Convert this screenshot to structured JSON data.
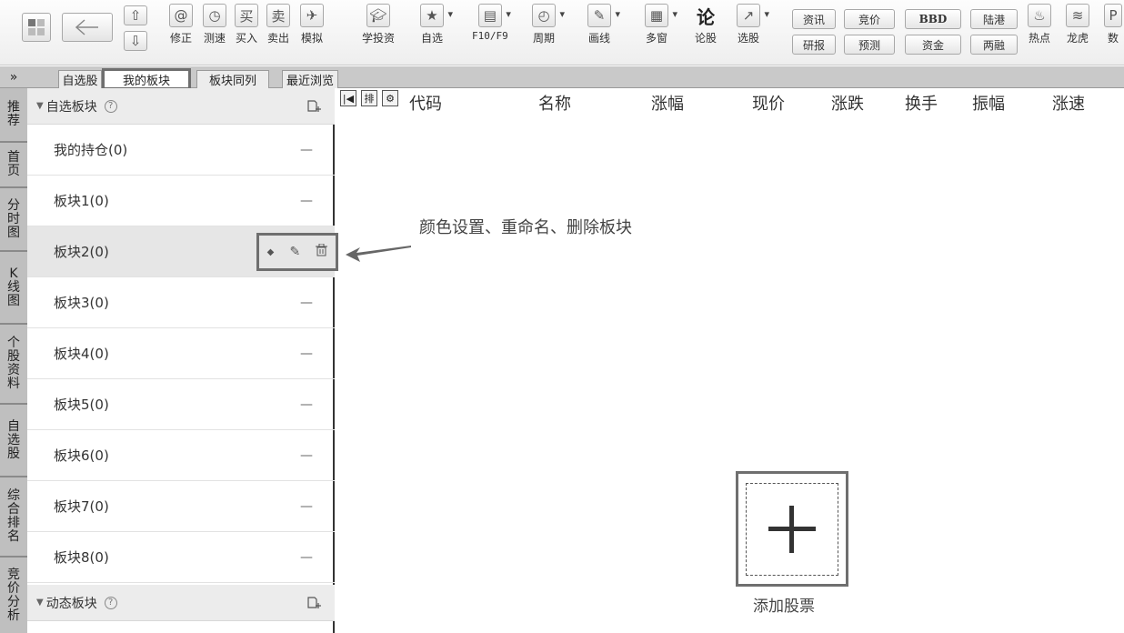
{
  "toolbar": {
    "nav_back_icon": "back-arrow-icon",
    "up_icon": "up-arrow-icon",
    "down_icon": "down-arrow-icon",
    "buttons": [
      {
        "label": "修正",
        "icon": "swirl-icon"
      },
      {
        "label": "测速",
        "icon": "clock-icon"
      },
      {
        "label": "买入",
        "icon": "buy-icon",
        "glyph": "买"
      },
      {
        "label": "卖出",
        "icon": "sell-icon",
        "glyph": "卖"
      },
      {
        "label": "模拟",
        "icon": "simulate-icon"
      },
      {
        "label": "学投资",
        "icon": "grad-cap-icon"
      },
      {
        "label": "自选",
        "icon": "star-folder-icon"
      },
      {
        "label": "F10/F9",
        "icon": "f10-icon"
      },
      {
        "label": "周期",
        "icon": "period-icon"
      },
      {
        "label": "画线",
        "icon": "pen-icon"
      },
      {
        "label": "多窗",
        "icon": "multiwindow-icon"
      },
      {
        "label": "论股",
        "icon": "discuss-icon",
        "glyph": "论"
      },
      {
        "label": "选股",
        "icon": "stock-select-icon"
      }
    ],
    "pills": [
      {
        "top": "资讯",
        "bottom": "研报"
      },
      {
        "top": "竞价",
        "bottom": "预测"
      },
      {
        "top": "BBD",
        "bottom": "资金"
      },
      {
        "top": "陆港",
        "bottom": "两融"
      }
    ],
    "right_buttons": [
      {
        "label": "热点",
        "icon": "hot-icon"
      },
      {
        "label": "龙虎",
        "icon": "dragon-icon"
      },
      {
        "label": "数",
        "icon": "data-icon"
      }
    ]
  },
  "tabs": {
    "expand": "»",
    "items": [
      "自选股",
      "我的板块",
      "板块同列",
      "最近浏览"
    ],
    "active": 1
  },
  "vnav": [
    "推荐",
    "首页",
    "分时图",
    "K线图",
    "个股资料",
    "自选股",
    "综合排名",
    "竞价分析"
  ],
  "sidebar": {
    "group1": {
      "title": "自选板块",
      "help": "?"
    },
    "rows": [
      {
        "name": "我的持仓(0)",
        "dash": "—"
      },
      {
        "name": "板块1(0)",
        "dash": "—"
      },
      {
        "name": "板块2(0)",
        "dash": ""
      },
      {
        "name": "板块3(0)",
        "dash": "—"
      },
      {
        "name": "板块4(0)",
        "dash": "—"
      },
      {
        "name": "板块5(0)",
        "dash": "—"
      },
      {
        "name": "板块6(0)",
        "dash": "—"
      },
      {
        "name": "板块7(0)",
        "dash": "—"
      },
      {
        "name": "板块8(0)",
        "dash": "—"
      }
    ],
    "selected_index": 2,
    "row_actions": [
      "◆",
      "✎",
      "🗑"
    ],
    "group2": {
      "title": "动态板块",
      "help": "?"
    }
  },
  "table": {
    "tools": [
      "|◀",
      "排",
      "⚙"
    ],
    "columns": [
      "代码",
      "名称",
      "涨幅",
      "现价",
      "涨跌",
      "换手",
      "振幅",
      "涨速"
    ]
  },
  "annotation": "颜色设置、重命名、删除板块",
  "add_stock": {
    "label": "添加股票",
    "plus": "+"
  }
}
